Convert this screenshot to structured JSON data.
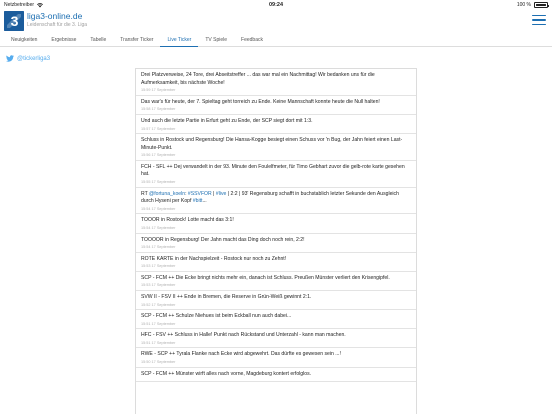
{
  "status_bar": {
    "carrier": "Netzbetreiber",
    "time": "09:24",
    "battery": "100 %",
    "wifi_icon": "wifi-icon",
    "battery_icon": "battery-icon"
  },
  "header": {
    "title": "liga3-online.de",
    "subtitle": "Leidenschaft für die 3. Liga",
    "logo_icon": "liga3-logo",
    "menu_icon": "hamburger-menu-icon"
  },
  "nav": {
    "items": [
      "Neuigkeiten",
      "Ergebnisse",
      "Tabelle",
      "Transfer Ticker",
      "Live Ticker",
      "TV Spiele",
      "Feedback"
    ],
    "active": "Live Ticker"
  },
  "twitter": {
    "handle": "@tickerliga3",
    "icon": "twitter-bird-icon",
    "color": "#55acee"
  },
  "colors": {
    "brand": "#1d6fb2",
    "logo_bg": "#1b5c9c"
  },
  "feed": [
    {
      "parts": [
        "Drei Platzverweise, 24 Tore, drei Abseitstreffer ... das war mal ein Nachmittag! Wir bedanken uns für die Aufmerksamkeit, bis nächste Woche!"
      ],
      "time": "15:59 17 September"
    },
    {
      "parts": [
        "Das war's für heute, der 7. Spieltag geht torreich zu Ende. Keine Mannschaft konnte heute die Null halten!"
      ],
      "time": "15:58 17 September"
    },
    {
      "parts": [
        "Und auch die letzte Partie in Erfurt geht zu Ende, der SCP siegt dort mit 1:3."
      ],
      "time": "15:57 17 September"
    },
    {
      "parts": [
        "Schluss in Rostock und Regensburg! Die Hansa-Kogge besiegt einen Schuss vor 'n Bug, der Jahn feiert einen Last-Minute-Punkt."
      ],
      "time": "15:56 17 September"
    },
    {
      "parts": [
        "FCH - SFL ++ Dej verwandelt in der 93. Minute den Foulelfmeter, für Timo Gebhart zuvor die gelb-rote karte gesehen hat."
      ],
      "time": "15:55 17 September"
    },
    {
      "parts": [
        "RT ",
        "@fortuna_koeln",
        ": ",
        "#SSVFOR",
        " | ",
        "#live",
        " | 2:2 | 93' Regensburg schafft in buchstablich letzter Sekunde den Ausgleich durch Hyseni per Kopf ",
        "#bitt",
        "..."
      ],
      "links": [
        1,
        3,
        5,
        7
      ],
      "time": "15:54 17 September"
    },
    {
      "parts": [
        "TOOOR in Rostock! Lotte macht das 3:1!"
      ],
      "time": "15:54 17 September"
    },
    {
      "parts": [
        "TOOOOR in Regensburg! Der Jahn macht das Ding doch noch rein, 2:2!"
      ],
      "time": "15:54 17 September"
    },
    {
      "parts": [
        "ROTE KARTE in der Nachspielzeit - Rostock nur noch zu Zehnt!"
      ],
      "time": "15:53 17 September"
    },
    {
      "parts": [
        "SCP - FCM ++ Die Ecke bringt nichts mehr ein, danach ist Schluss. Preußen Münster verliert den Krisengipfel."
      ],
      "time": "15:53 17 September"
    },
    {
      "parts": [
        "SVW II - FSV II ++ Ende in Bremen, die Reserve in Grün-Weiß gewinnt 2:1."
      ],
      "time": "15:52 17 September"
    },
    {
      "parts": [
        "SCP - FCM ++ Schulze Niehues ist beim Eckball nun auch dabei..."
      ],
      "time": "15:51 17 September"
    },
    {
      "parts": [
        "HFC - FSV ++ Schluss in Halle! Punkt nach Rückstand und Unterzahl - kann man machen."
      ],
      "time": "15:51 17 September"
    },
    {
      "parts": [
        "RWE - SCP ++ Tyrala Flanke nach Ecke wird abgewehrt. Das dürfte es gewesen sein ...!"
      ],
      "time": "15:50 17 September"
    },
    {
      "parts": [
        "SCP - FCM ++ Münster wirft alles nach vorne, Magdeburg kontert erfolglos."
      ],
      "time": ""
    }
  ]
}
